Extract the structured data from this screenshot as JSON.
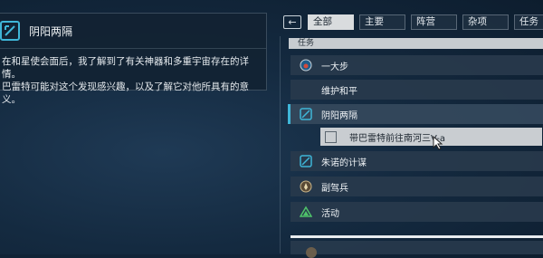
{
  "info": {
    "title": "阴阳两隔",
    "desc_line1": "在和星使会面后，我了解到了有关神器和多重宇宙存在的详情。",
    "desc_line2": "巴雷特可能对这个发现感兴趣，以及了解它对他所具有的意义。"
  },
  "toolbar": {
    "back_glyph": "←"
  },
  "tabs": [
    "全部",
    "主要",
    "阵营",
    "杂项",
    "任务"
  ],
  "list_header": "任务",
  "quests": [
    {
      "label": "一大步",
      "icon": "planet-badge-icon"
    },
    {
      "label": "维护和平",
      "icon": "none"
    },
    {
      "label": "阴阳两隔",
      "icon": "quest-diamond-icon"
    },
    {
      "label": "朱诺的计谋",
      "icon": "quest-diamond-icon"
    },
    {
      "label": "副驾兵",
      "icon": "faction-badge-icon"
    },
    {
      "label": "活动",
      "icon": "triangle-icon"
    }
  ],
  "objective": {
    "label": "带巴雷特前往南河三V-a",
    "checked": false
  },
  "colors": {
    "accent": "#3fb6d8",
    "tab_active_bg": "#d9dcde",
    "row_bg": "#28394b"
  }
}
